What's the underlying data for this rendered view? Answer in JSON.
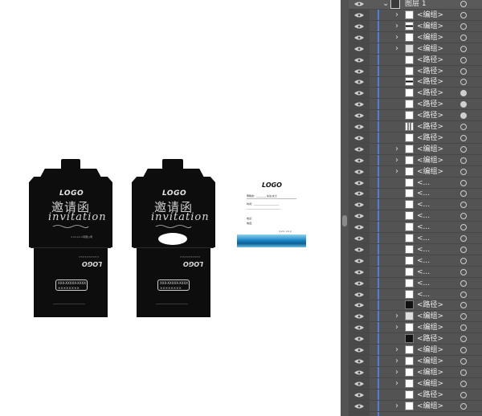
{
  "canvas": {
    "envelope_left": {
      "logo": "LOGO",
      "chinese_title": "邀请函",
      "invitation": "invitation",
      "company_line": "××××××有限公司",
      "back_logo": "LOGO",
      "phone_line1": "XXX-XXXXX-XXXX",
      "phone_line2": "××××××××"
    },
    "envelope_right": {
      "logo": "LOGO",
      "chinese_title": "邀请函",
      "invitation": "invitation",
      "back_logo": "LOGO",
      "phone_line1": "XXX-XXXXX-XXXX",
      "phone_line2": "××××××××"
    },
    "card": {
      "logo": "LOGO",
      "line1": "尊敬的：________ 先生/女士",
      "line2": "时间：_____________________",
      "line3": "____________________________",
      "line4": "地点：",
      "line5": "电话：",
      "sign": "××× ×××"
    }
  },
  "layers_panel": {
    "accent_color": "#4f7fd8",
    "background_color": "#535353",
    "top_layer": {
      "name": "图层 1",
      "expanded": true
    },
    "rows": [
      {
        "label": "<编组>",
        "chevron": true,
        "thumb": "white",
        "target_filled": false
      },
      {
        "label": "<编组>",
        "chevron": true,
        "thumb": "stripe",
        "target_filled": false
      },
      {
        "label": "<编组>",
        "chevron": true,
        "thumb": "white",
        "target_filled": false
      },
      {
        "label": "<编组>",
        "chevron": true,
        "thumb": "gray",
        "target_filled": false
      },
      {
        "label": "<路径>",
        "chevron": false,
        "thumb": "white",
        "target_filled": false
      },
      {
        "label": "<路径>",
        "chevron": false,
        "thumb": "white",
        "target_filled": false
      },
      {
        "label": "<路径>",
        "chevron": false,
        "thumb": "stripe",
        "target_filled": false
      },
      {
        "label": "<路径>",
        "chevron": false,
        "thumb": "white",
        "target_filled": true
      },
      {
        "label": "<路径>",
        "chevron": false,
        "thumb": "white",
        "target_filled": true
      },
      {
        "label": "<路径>",
        "chevron": false,
        "thumb": "white",
        "target_filled": true
      },
      {
        "label": "<路径>",
        "chevron": false,
        "thumb": "vbars",
        "target_filled": false
      },
      {
        "label": "<路径>",
        "chevron": false,
        "thumb": "white",
        "target_filled": false
      },
      {
        "label": "<编组>",
        "chevron": true,
        "thumb": "white",
        "target_filled": false
      },
      {
        "label": "<编组>",
        "chevron": true,
        "thumb": "white",
        "target_filled": false
      },
      {
        "label": "<编组>",
        "chevron": true,
        "thumb": "white",
        "target_filled": false
      },
      {
        "label": "<...",
        "chevron": false,
        "thumb": "white",
        "target_filled": false
      },
      {
        "label": "<...",
        "chevron": false,
        "thumb": "white",
        "target_filled": false
      },
      {
        "label": "<...",
        "chevron": false,
        "thumb": "white",
        "target_filled": false
      },
      {
        "label": "<...",
        "chevron": false,
        "thumb": "white",
        "target_filled": false
      },
      {
        "label": "<...",
        "chevron": false,
        "thumb": "white",
        "target_filled": false
      },
      {
        "label": "<...",
        "chevron": false,
        "thumb": "white",
        "target_filled": false
      },
      {
        "label": "<...",
        "chevron": false,
        "thumb": "white",
        "target_filled": false
      },
      {
        "label": "<...",
        "chevron": false,
        "thumb": "white",
        "target_filled": false
      },
      {
        "label": "<...",
        "chevron": false,
        "thumb": "white",
        "target_filled": false
      },
      {
        "label": "<...",
        "chevron": false,
        "thumb": "white",
        "target_filled": false
      },
      {
        "label": "<...",
        "chevron": false,
        "thumb": "white",
        "target_filled": false
      },
      {
        "label": "<路径>",
        "chevron": false,
        "thumb": "dark",
        "target_filled": false
      },
      {
        "label": "<编组>",
        "chevron": true,
        "thumb": "gray",
        "target_filled": false
      },
      {
        "label": "<编组>",
        "chevron": true,
        "thumb": "white",
        "target_filled": false
      },
      {
        "label": "<路径>",
        "chevron": false,
        "thumb": "dark",
        "target_filled": false
      },
      {
        "label": "<编组>",
        "chevron": true,
        "thumb": "white",
        "target_filled": false
      },
      {
        "label": "<编组>",
        "chevron": true,
        "thumb": "white",
        "target_filled": false
      },
      {
        "label": "<编组>",
        "chevron": true,
        "thumb": "white",
        "target_filled": false
      },
      {
        "label": "<编组>",
        "chevron": true,
        "thumb": "white",
        "target_filled": false
      },
      {
        "label": "<路径>",
        "chevron": false,
        "thumb": "white",
        "target_filled": false
      },
      {
        "label": "<编组>",
        "chevron": true,
        "thumb": "white",
        "target_filled": false
      }
    ]
  }
}
